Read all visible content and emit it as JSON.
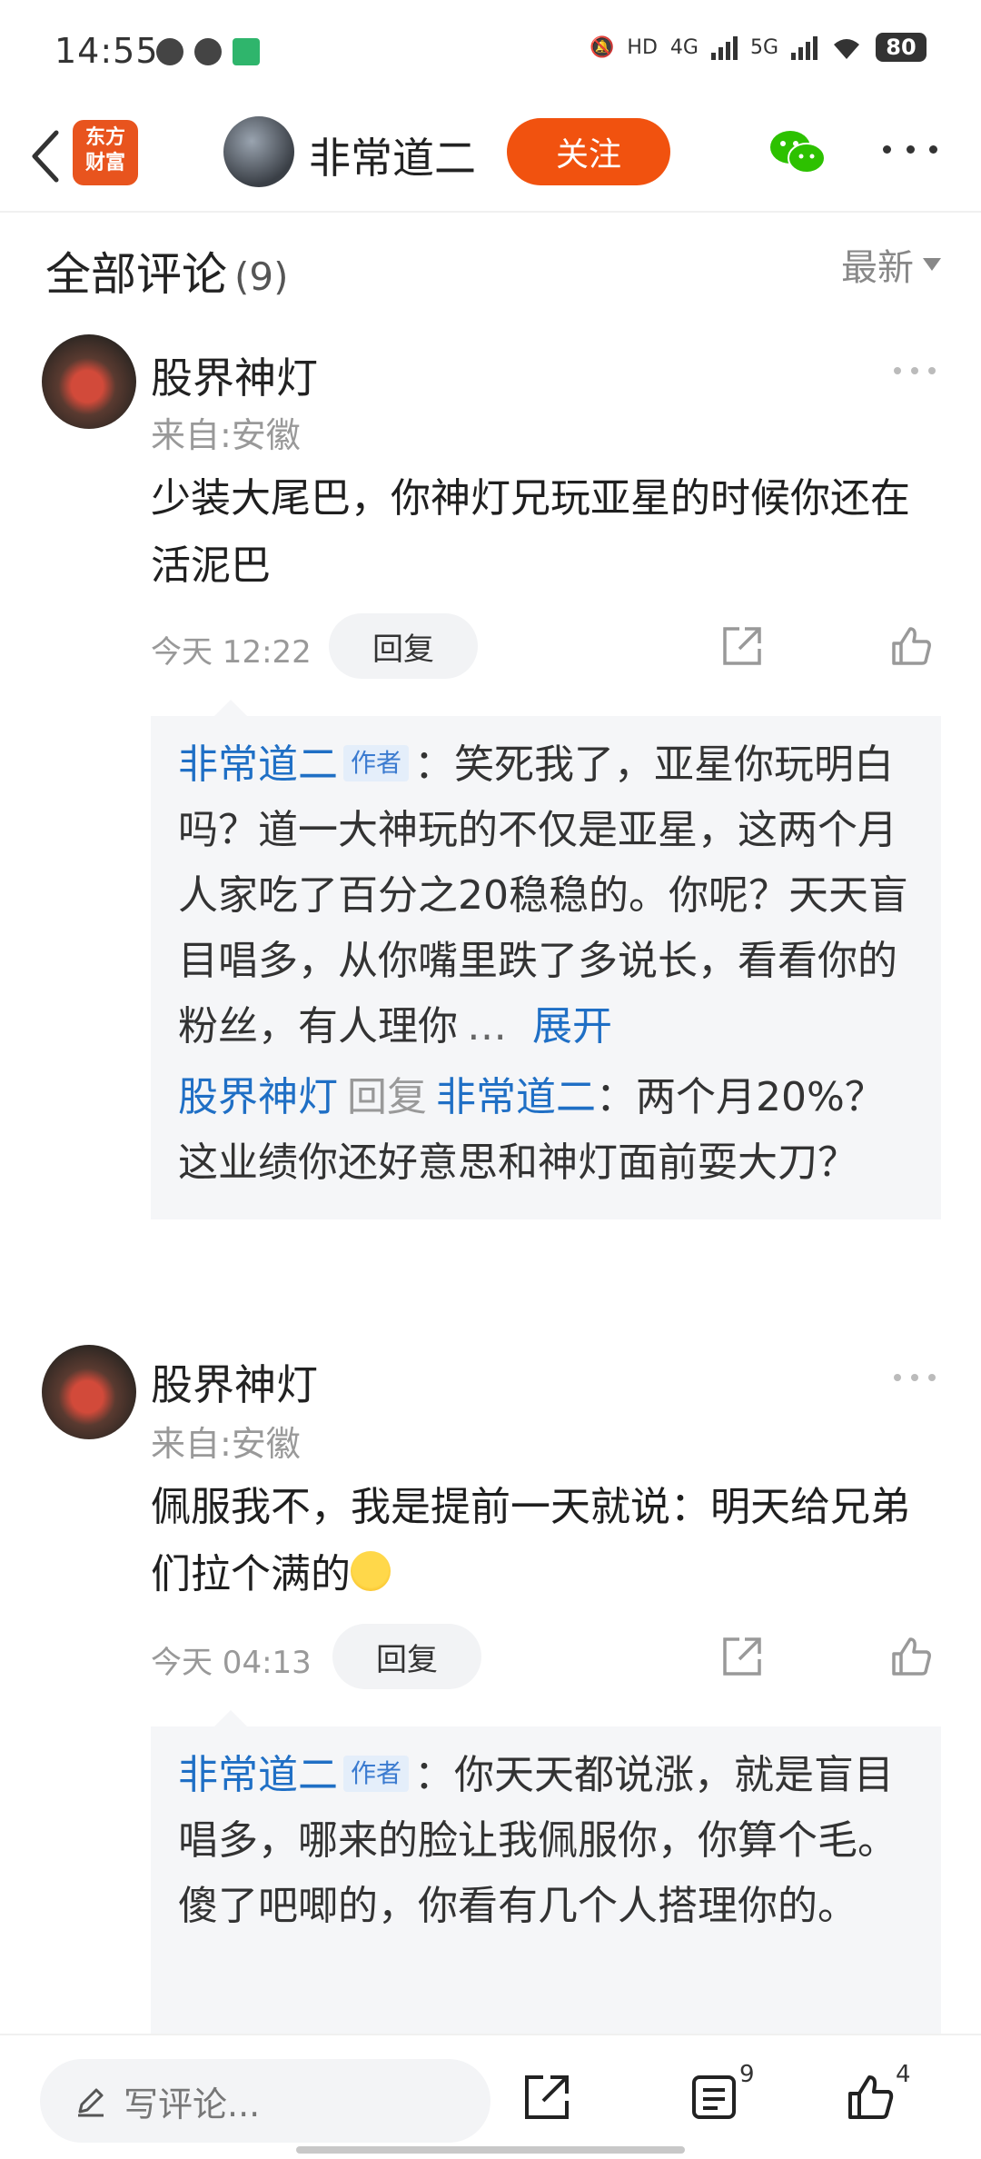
{
  "status_bar": {
    "time": "14:55",
    "battery": "80",
    "network_labels": [
      "HD",
      "4G",
      "5G"
    ]
  },
  "nav": {
    "app_logo_text": [
      "东方",
      "财富"
    ],
    "author_name": "非常道二",
    "follow_label": "关注",
    "icons": [
      "back-arrow-icon",
      "wechat-icon",
      "more-icon"
    ]
  },
  "section": {
    "title": "全部评论",
    "count": "(9)",
    "sort_label": "最新"
  },
  "comments": [
    {
      "author": "股界神灯",
      "location": "来自:安徽",
      "text": "少装大尾巴，你神灯兄玩亚星的时候你还在活泥巴",
      "time": "今天 12:22",
      "reply_label": "回复",
      "replies": [
        {
          "author": "非常道二",
          "tag": "作者",
          "text": "：笑死我了，亚星你玩明白吗？道一大神玩的不仅是亚星，这两个月人家吃了百分之20稳稳的。你呢？天天盲目唱多，从你嘴里跌了多说长，看看你的粉丝，有人理你",
          "ellipsis": "…",
          "expand_label": "展开"
        },
        {
          "author": "股界神灯",
          "reply_word": "回复",
          "target": "非常道二",
          "text": "：两个月20%？这业绩你还好意思和神灯面前耍大刀？"
        }
      ]
    },
    {
      "author": "股界神灯",
      "location": "来自:安徽",
      "text": "佩服我不，我是提前一天就说：明天给兄弟们拉个满的",
      "time": "今天 04:13",
      "reply_label": "回复",
      "replies": [
        {
          "author": "非常道二",
          "tag": "作者",
          "text": "：你天天都说涨，就是盲目唱多，哪来的脸让我佩服你，你算个毛。傻了吧唧的，你看有几个人搭理你的。"
        }
      ]
    }
  ],
  "bottom_bar": {
    "input_placeholder": "写评论...",
    "comment_count": "9",
    "like_count": "4"
  },
  "colors": {
    "accent_orange": "#f1520f",
    "link_blue": "#1f6fc5",
    "reply_bg": "#f5f6f8"
  }
}
